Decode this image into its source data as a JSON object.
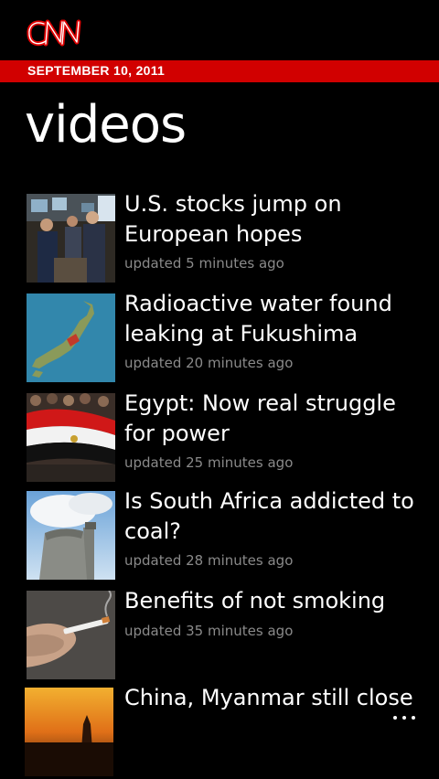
{
  "app": {
    "logo_text": "CNN",
    "brand_color": "#d10000"
  },
  "date_bar": {
    "text": "SEPTEMBER 10, 2011"
  },
  "page": {
    "title": "videos"
  },
  "videos": [
    {
      "headline": "U.S. stocks jump on European hopes",
      "updated": "updated 5 minutes ago",
      "thumb_icon": "stock-traders-thumbnail"
    },
    {
      "headline": "Radioactive water found leaking at Fukushima",
      "updated": "updated 20 minutes ago",
      "thumb_icon": "japan-map-thumbnail"
    },
    {
      "headline": "Egypt: Now real struggle for power",
      "updated": "updated 25 minutes ago",
      "thumb_icon": "egypt-flag-crowd-thumbnail"
    },
    {
      "headline": "Is South Africa addicted to coal?",
      "updated": "updated 28 minutes ago",
      "thumb_icon": "cooling-tower-thumbnail"
    },
    {
      "headline": "Benefits of not smoking",
      "updated": "updated 35 minutes ago",
      "thumb_icon": "cigarette-hand-thumbnail"
    },
    {
      "headline": "China, Myanmar still close",
      "updated": "",
      "thumb_icon": "sunset-stupa-thumbnail"
    }
  ],
  "app_bar": {
    "more_icon": "ellipsis-icon"
  }
}
